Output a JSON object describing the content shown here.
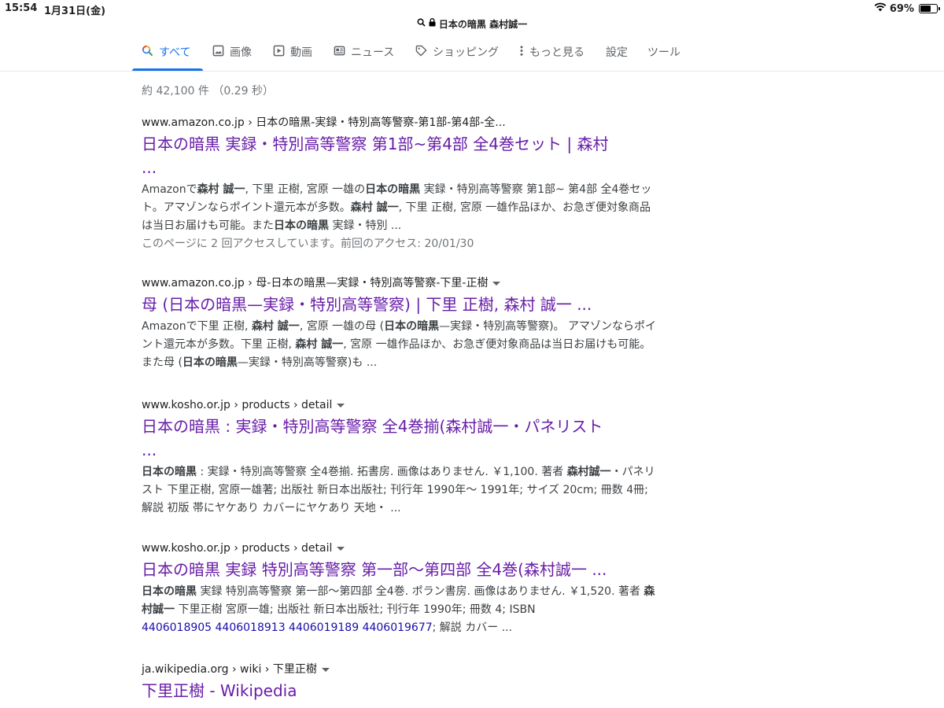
{
  "status": {
    "time": "15:54",
    "date": "1月31日(金)",
    "battery": "69%",
    "battery_level": 0.69
  },
  "urlbar": {
    "text": "日本の暗黒 森村誠一"
  },
  "tabs": [
    {
      "label": "すべて",
      "icon": "search-icon",
      "active": true
    },
    {
      "label": "画像",
      "icon": "image-icon"
    },
    {
      "label": "動画",
      "icon": "video-icon"
    },
    {
      "label": "ニュース",
      "icon": "news-icon"
    },
    {
      "label": "ショッピング",
      "icon": "tag-icon"
    },
    {
      "label": "もっと見る",
      "icon": "more-vert-icon"
    },
    {
      "label": "設定"
    },
    {
      "label": "ツール"
    }
  ],
  "stats": "約 42,100 件 （0.29 秒）",
  "results": [
    {
      "crumb": "www.amazon.co.jp › 日本の暗黒-実録・特別高等警察-第1部-第4部-全...",
      "title_line1": "日本の暗黒 実録・特別高等警察 第1部~第4部 全4巻セット | 森村",
      "title_line2": "...",
      "snippet": "Amazonで<b>森村 誠一</b>, 下里 正樹, 宮原 一雄の<b>日本の暗黒</b> 実録・特別高等警察 第1部~ 第4部 全4巻セット。アマゾンならポイント還元本が多数。<b>森村 誠一</b>, 下里 正樹, 宮原 一雄作品ほか、お急ぎ便対象商品は当日お届けも可能。また<b>日本の暗黒</b> 実録・特別 ...",
      "visited": "このページに 2 回アクセスしています。前回のアクセス: 20/01/30"
    },
    {
      "crumb": "www.amazon.co.jp › 母-日本の暗黒—実録・特別高等警察-下里-正樹",
      "title_line1": "母 (日本の暗黒—実録・特別高等警察) | 下里 正樹, 森村 誠一 ...",
      "snippet": "Amazonで下里 正樹, <b>森村 誠一</b>, 宮原 一雄の母 (<b>日本の暗黒</b>—実録・特別高等警察)。 アマゾンならポイント還元本が多数。下里 正樹, <b>森村 誠一</b>, 宮原 一雄作品ほか、お急ぎ便対象商品は当日お届けも可能。また母 (<b>日本の暗黒</b>—実録・特別高等警察)も ..."
    },
    {
      "crumb": "www.kosho.or.jp › products › detail",
      "title_line1": "日本の暗黒 : 実録・特別高等警察 全4巻揃(森村誠一・パネリスト",
      "title_line2": "...",
      "snippet": "<b>日本の暗黒</b> : 実録・特別高等警察 全4巻揃. 拓書房. 画像はありません. ￥1,100. 著者 <b>森村誠一</b>・パネリスト 下里正樹, 宮原一雄著; 出版社 新日本出版社; 刊行年 1990年～ 1991年; サイズ 20cm; 冊数 4冊; 解説 初版 帯にヤケあり カバーにヤケあり 天地・ ..."
    },
    {
      "crumb": "www.kosho.or.jp › products › detail",
      "title_line1": "日本の暗黒 実録 特別高等警察 第一部～第四部 全4巻(森村誠一 ...",
      "snippet": "<b>日本の暗黒</b> 実録 特別高等警察 第一部～第四部 全4巻. ポラン書房. 画像はありません. ￥1,520. 著者 <b>森村誠一</b> 下里正樹 宮原一雄; 出版社 新日本出版社; 刊行年 1990年; 冊数 4; ISBN",
      "isbns": "4406018905 4406018913 4406019189 4406019677",
      "snippet_tail": "; 解説 カバー ..."
    },
    {
      "crumb": "ja.wikipedia.org › wiki › 下里正樹",
      "title_line1": "下里正樹 - Wikipedia"
    }
  ]
}
